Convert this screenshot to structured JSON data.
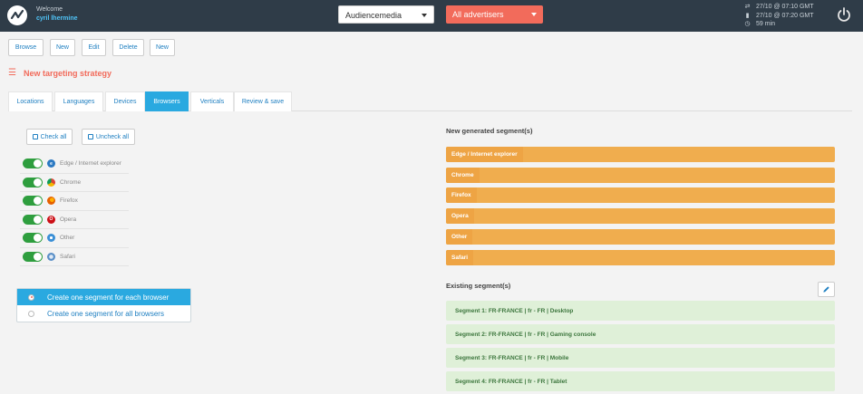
{
  "header": {
    "welcome_label": "Welcome",
    "username": "cyril lhermine",
    "media_select": "Audiencemedia",
    "advertiser_select": "All advertisers",
    "sync_times": [
      {
        "icon": "sync-icon",
        "text": "27/10 @ 07:10 GMT"
      },
      {
        "icon": "chart-icon",
        "text": "27/10 @ 07:20 GMT"
      },
      {
        "icon": "clock-icon",
        "text": "59 min"
      }
    ]
  },
  "toolbar": {
    "browse": "Browse",
    "new1": "New",
    "edit": "Edit",
    "delete": "Delete",
    "new2": "New"
  },
  "page": {
    "title": "New targeting strategy"
  },
  "tabs": [
    {
      "label": "Locations"
    },
    {
      "label": "Languages"
    },
    {
      "label": "Devices"
    },
    {
      "label": "Browsers"
    },
    {
      "label": "Verticals"
    },
    {
      "label": "Review & save"
    }
  ],
  "actions": {
    "check_all": "Check all",
    "uncheck_all": "Uncheck all"
  },
  "browsers": [
    {
      "label": "Edge / Internet explorer",
      "enabled": true,
      "color": "#2b79c2",
      "glyph": "e"
    },
    {
      "label": "Chrome",
      "enabled": true,
      "color": "#db4437",
      "glyph": ""
    },
    {
      "label": "Firefox",
      "enabled": true,
      "color": "#e66000",
      "glyph": ""
    },
    {
      "label": "Opera",
      "enabled": true,
      "color": "#cc0f16",
      "glyph": "O"
    },
    {
      "label": "Other",
      "enabled": true,
      "color": "#3a8fd6",
      "glyph": ""
    },
    {
      "label": "Safari",
      "enabled": true,
      "color": "#5a8fc7",
      "glyph": ""
    }
  ],
  "segment_mode": {
    "options": [
      {
        "label": "Create one segment for each browser",
        "selected": true
      },
      {
        "label": "Create one segment for all browsers",
        "selected": false
      }
    ]
  },
  "new_segments": {
    "title": "New generated segment(s)",
    "items": [
      "Edge / Internet explorer",
      "Chrome",
      "Firefox",
      "Opera",
      "Other",
      "Safari"
    ]
  },
  "existing_segments": {
    "title": "Existing segment(s)",
    "items": [
      "Segment 1: FR-FRANCE | fr - FR | Desktop",
      "Segment 2: FR-FRANCE | fr - FR | Gaming console",
      "Segment 3: FR-FRANCE | fr - FR | Mobile",
      "Segment 4: FR-FRANCE | fr - FR | Tablet"
    ]
  },
  "colors": {
    "topbar": "#2f3c48",
    "accent": "#f26b5b",
    "tab_active": "#2aa9e0",
    "new_segment": "#f0ad4e",
    "existing_segment": "#dff0d8",
    "toggle_on": "#2e9e3e"
  }
}
